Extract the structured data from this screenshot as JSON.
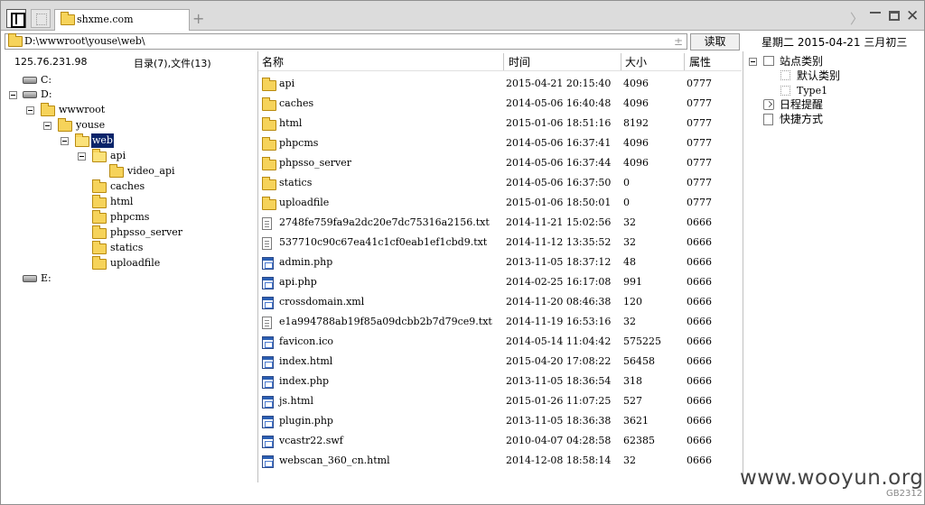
{
  "tab": {
    "label": "shxme.com",
    "add_label": "+"
  },
  "window": {
    "next_label": "〉",
    "close_label": "✕"
  },
  "address": {
    "path": "D:\\wwwroot\\youse\\web\\",
    "spin": "±",
    "read_label": "读取"
  },
  "date_info": "星期二  2015-04-21  三月初三",
  "status": {
    "ip": "125.76.231.98",
    "counts": "目录(7),文件(13)"
  },
  "columns": {
    "name": "名称",
    "time": "时间",
    "size": "大小",
    "attr": "属性"
  },
  "tree": [
    {
      "label": "C:",
      "type": "drive"
    },
    {
      "label": "D:",
      "type": "drive"
    },
    {
      "label": "wwwroot",
      "type": "folder"
    },
    {
      "label": "youse",
      "type": "folder"
    },
    {
      "label": "web",
      "type": "folder",
      "selected": true
    },
    {
      "label": "api",
      "type": "folder"
    },
    {
      "label": "video_api",
      "type": "folder"
    },
    {
      "label": "caches",
      "type": "folder"
    },
    {
      "label": "html",
      "type": "folder"
    },
    {
      "label": "phpcms",
      "type": "folder"
    },
    {
      "label": "phpsso_server",
      "type": "folder"
    },
    {
      "label": "statics",
      "type": "folder"
    },
    {
      "label": "uploadfile",
      "type": "folder"
    },
    {
      "label": "E:",
      "type": "drive"
    }
  ],
  "files": [
    {
      "name": "api",
      "time": "2015-04-21 20:15:40",
      "size": "4096",
      "attr": "0777",
      "icon": "folder-icon"
    },
    {
      "name": "caches",
      "time": "2014-05-06 16:40:48",
      "size": "4096",
      "attr": "0777",
      "icon": "folder-icon"
    },
    {
      "name": "html",
      "time": "2015-01-06 18:51:16",
      "size": "8192",
      "attr": "0777",
      "icon": "folder-icon"
    },
    {
      "name": "phpcms",
      "time": "2014-05-06 16:37:41",
      "size": "4096",
      "attr": "0777",
      "icon": "folder-icon"
    },
    {
      "name": "phpsso_server",
      "time": "2014-05-06 16:37:44",
      "size": "4096",
      "attr": "0777",
      "icon": "folder-icon"
    },
    {
      "name": "statics",
      "time": "2014-05-06 16:37:50",
      "size": "0",
      "attr": "0777",
      "icon": "folder-icon"
    },
    {
      "name": "uploadfile",
      "time": "2015-01-06 18:50:01",
      "size": "0",
      "attr": "0777",
      "icon": "folder-icon"
    },
    {
      "name": "2748fe759fa9a2dc20e7dc75316a2156.txt",
      "time": "2014-11-21 15:02:56",
      "size": "32",
      "attr": "0666",
      "icon": "text-file-icon"
    },
    {
      "name": "537710c90c67ea41c1cf0eab1ef1cbd9.txt",
      "time": "2014-11-12 13:35:52",
      "size": "32",
      "attr": "0666",
      "icon": "text-file-icon"
    },
    {
      "name": "admin.php",
      "time": "2013-11-05 18:37:12",
      "size": "48",
      "attr": "0666",
      "icon": "web-file-icon"
    },
    {
      "name": "api.php",
      "time": "2014-02-25 16:17:08",
      "size": "991",
      "attr": "0666",
      "icon": "web-file-icon"
    },
    {
      "name": "crossdomain.xml",
      "time": "2014-11-20 08:46:38",
      "size": "120",
      "attr": "0666",
      "icon": "web-file-icon"
    },
    {
      "name": "e1a994788ab19f85a09dcbb2b7d79ce9.txt",
      "time": "2014-11-19 16:53:16",
      "size": "32",
      "attr": "0666",
      "icon": "text-file-icon"
    },
    {
      "name": "favicon.ico",
      "time": "2014-05-14 11:04:42",
      "size": "575225",
      "attr": "0666",
      "icon": "web-file-icon"
    },
    {
      "name": "index.html",
      "time": "2015-04-20 17:08:22",
      "size": "56458",
      "attr": "0666",
      "icon": "web-file-icon"
    },
    {
      "name": "index.php",
      "time": "2013-11-05 18:36:54",
      "size": "318",
      "attr": "0666",
      "icon": "web-file-icon"
    },
    {
      "name": "js.html",
      "time": "2015-01-26 11:07:25",
      "size": "527",
      "attr": "0666",
      "icon": "web-file-icon"
    },
    {
      "name": "plugin.php",
      "time": "2013-11-05 18:36:38",
      "size": "3621",
      "attr": "0666",
      "icon": "web-file-icon"
    },
    {
      "name": "vcastr22.swf",
      "time": "2010-04-07 04:28:58",
      "size": "62385",
      "attr": "0666",
      "icon": "web-file-icon"
    },
    {
      "name": "webscan_360_cn.html",
      "time": "2014-12-08 18:58:14",
      "size": "32",
      "attr": "0666",
      "icon": "web-file-icon"
    }
  ],
  "right_panel": {
    "site_category": "站点类别",
    "default_category": "默认类别",
    "type1": "Type1",
    "schedule": "日程提醒",
    "shortcuts": "快捷方式"
  },
  "watermark": "www.wooyun.org",
  "encoding": "GB2312"
}
